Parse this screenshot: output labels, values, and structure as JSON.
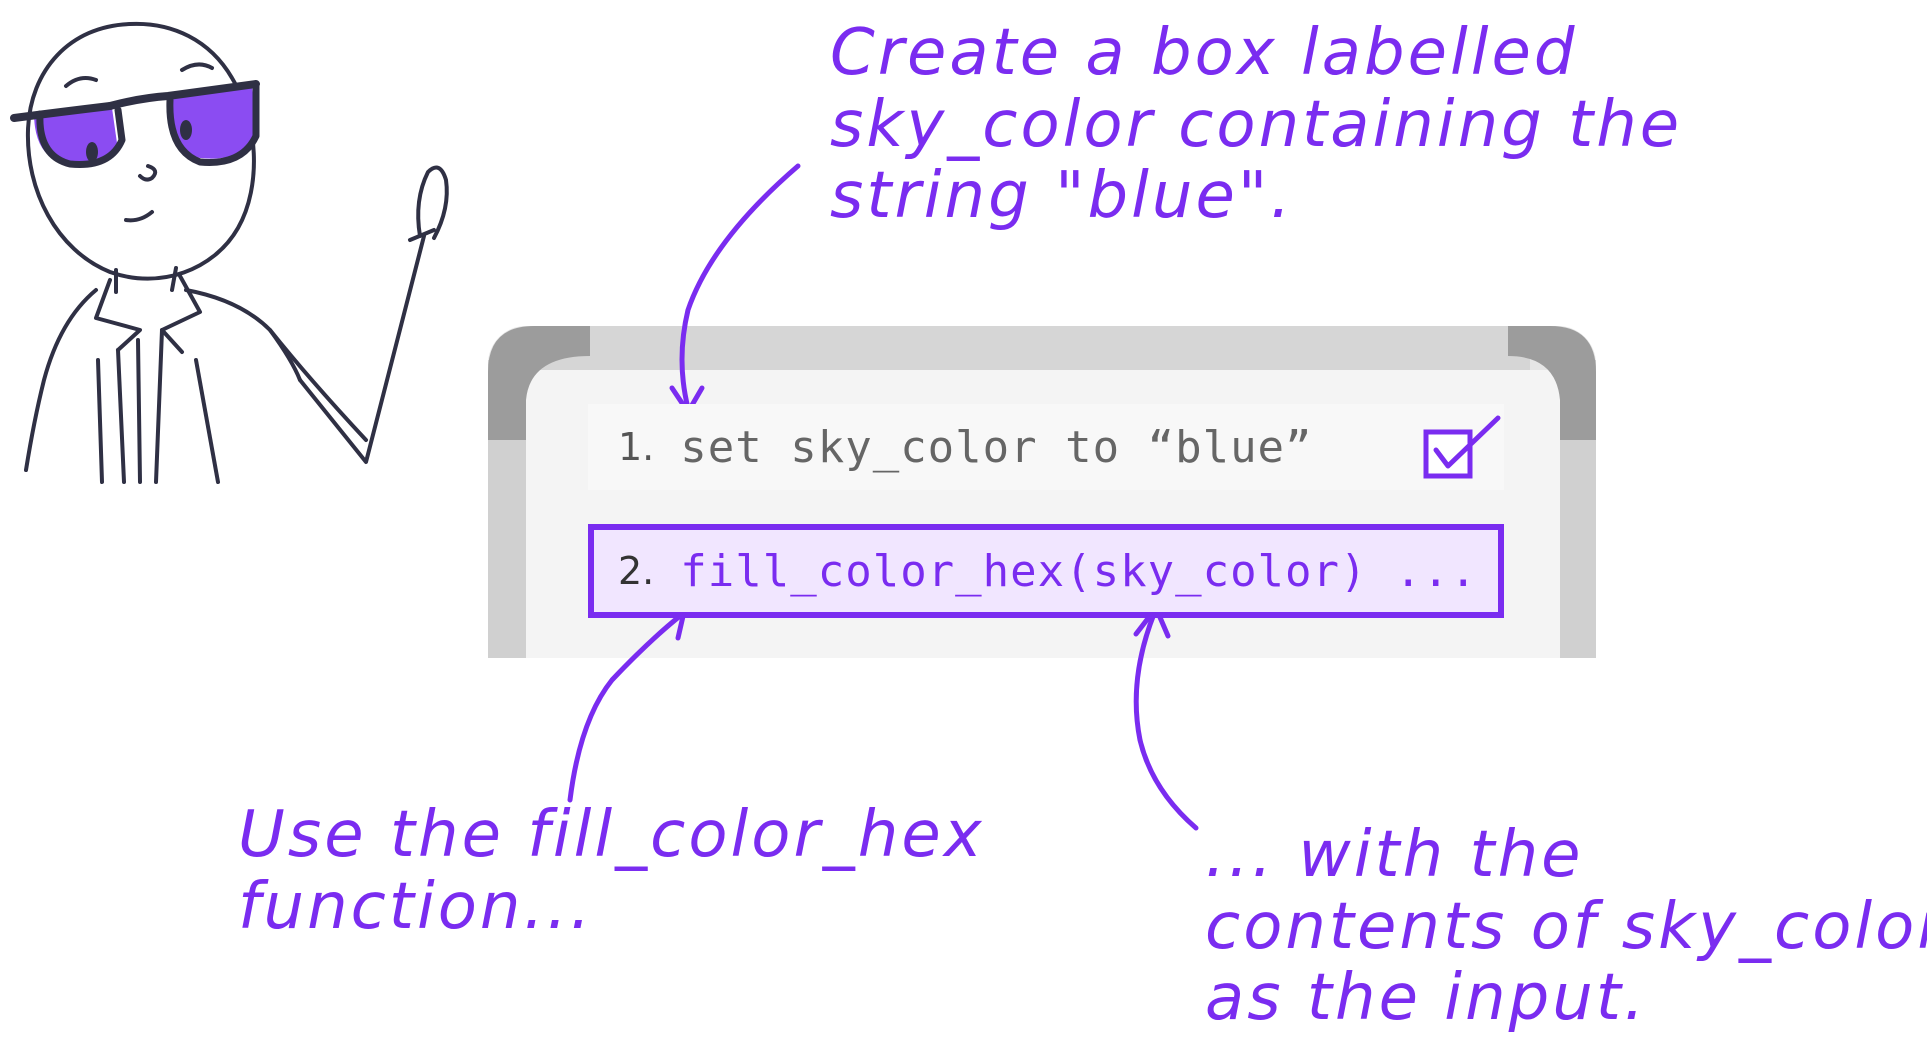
{
  "annotations": {
    "top": [
      "Create a box labelled",
      "sky_color containing the",
      "string \"blue\"."
    ],
    "left": [
      "Use the fill_color_hex",
      "function..."
    ],
    "right": [
      "... with the",
      "contents of sky_color",
      "as the input."
    ]
  },
  "code_lines": [
    {
      "number": "1.",
      "code": "set sky_color to “blue”",
      "done": true
    },
    {
      "number": "2.",
      "code": "fill_color_hex(sky_color) ...",
      "highlighted": true
    }
  ],
  "icons": {
    "check": "checkbox-checked-icon",
    "character": "scientist-with-glasses"
  },
  "colors": {
    "accent": "#7a2cf0",
    "board_frame": "#d6d6d6",
    "board_corner": "#9c9c9c",
    "highlight_fill": "#f1e6ff"
  }
}
